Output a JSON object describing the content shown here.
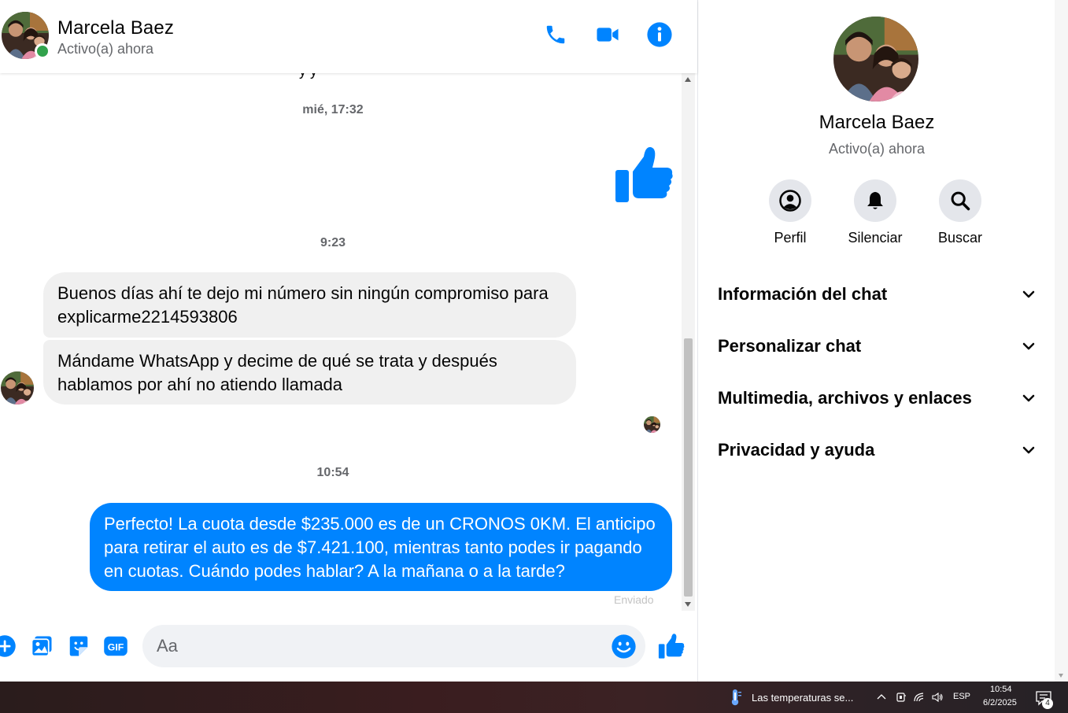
{
  "contact": {
    "name": "Marcela Baez",
    "status": "Activo(a) ahora"
  },
  "header": {
    "icons": [
      "phone-icon",
      "video-camera-icon",
      "info-icon"
    ]
  },
  "messages": {
    "cut_off_text": "y                    y",
    "timestamps": [
      "mié, 17:32",
      "9:23",
      "10:54"
    ],
    "incoming": [
      "Buenos días ahí te dejo mi número sin ningún compromiso para explicarme2214593806",
      "Mándame WhatsApp y decime de qué se trata y después hablamos por ahí no atiendo llamada"
    ],
    "outgoing": "Perfecto! La cuota desde $235.000 es de un CRONOS 0KM. El anticipo para retirar el auto es de $7.421.100, mientras tanto podes ir pagando en cuotas. Cuándo podes hablar? A la mañana o a la tarde?",
    "sent_status": "Enviado"
  },
  "composer": {
    "placeholder": "Aa",
    "icons": [
      "plus-icon",
      "photo-icon",
      "sticker-icon",
      "gif-icon",
      "emoji-icon",
      "like-icon"
    ]
  },
  "info_panel": {
    "actions": [
      {
        "label": "Perfil",
        "icon": "profile-icon"
      },
      {
        "label": "Silenciar",
        "icon": "bell-icon"
      },
      {
        "label": "Buscar",
        "icon": "search-icon"
      }
    ],
    "sections": [
      "Información del chat",
      "Personalizar chat",
      "Multimedia, archivos y enlaces",
      "Privacidad y ayuda"
    ]
  },
  "taskbar": {
    "weather_text": "Las temperaturas se...",
    "language": "ESP",
    "time": "10:54",
    "date": "6/2/2025",
    "notification_count": "4"
  },
  "colors": {
    "accent": "#0084ff",
    "incoming_bubble": "#f0f0f0",
    "online": "#31a24c"
  }
}
